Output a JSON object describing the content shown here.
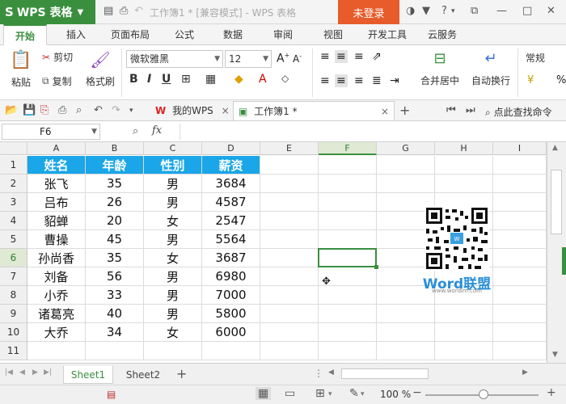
{
  "app": {
    "name": "WPS 表格",
    "logo_letter": "S",
    "doc_title": "工作簿1 * [兼容模式] - WPS 表格",
    "login": "未登录"
  },
  "title_icons": [
    "shirt-icon",
    "help-icon",
    "restore-icon",
    "minimize-icon",
    "maximize-icon",
    "close-icon"
  ],
  "ribbon_tabs": [
    "开始",
    "插入",
    "页面布局",
    "公式",
    "数据",
    "审阅",
    "视图",
    "开发工具",
    "云服务"
  ],
  "ribbon": {
    "paste": "粘贴",
    "cut": "剪切",
    "copy": "复制",
    "format_painter": "格式刷",
    "font_name": "微软雅黑",
    "font_size": "12",
    "bold": "B",
    "italic": "I",
    "underline": "U",
    "merge": "合并居中",
    "wrap": "自动换行",
    "number_format": "常规"
  },
  "docbar": {
    "tab_wps": "我的WPS",
    "tab_book": "工作簿1 *",
    "add": "+",
    "search": "点此查找命令"
  },
  "formula": {
    "cell_ref": "F6",
    "fx": "fx",
    "value": ""
  },
  "columns": [
    "A",
    "B",
    "C",
    "D",
    "E",
    "F",
    "G",
    "H",
    "I"
  ],
  "rows": [
    "1",
    "2",
    "3",
    "4",
    "5",
    "6",
    "7",
    "8",
    "9",
    "10",
    "11"
  ],
  "table": {
    "headers": [
      "姓名",
      "年龄",
      "性别",
      "薪资"
    ],
    "rows": [
      [
        "张飞",
        "35",
        "男",
        "3684"
      ],
      [
        "吕布",
        "26",
        "男",
        "4587"
      ],
      [
        "貂蝉",
        "20",
        "女",
        "2547"
      ],
      [
        "曹操",
        "45",
        "男",
        "5564"
      ],
      [
        "孙尚香",
        "35",
        "女",
        "3687"
      ],
      [
        "刘备",
        "56",
        "男",
        "6980"
      ],
      [
        "小乔",
        "33",
        "男",
        "7000"
      ],
      [
        "诸葛亮",
        "40",
        "男",
        "5800"
      ],
      [
        "大乔",
        "34",
        "女",
        "6000"
      ]
    ]
  },
  "watermark": {
    "brand": "Word联盟",
    "url": "www.wordlm.com"
  },
  "sheets": [
    "Sheet1",
    "Sheet2"
  ],
  "status": {
    "zoom": "100 %"
  },
  "colors": {
    "green": "#3a8f3e",
    "header_blue": "#1aa6e8",
    "orange": "#e85c2c"
  }
}
